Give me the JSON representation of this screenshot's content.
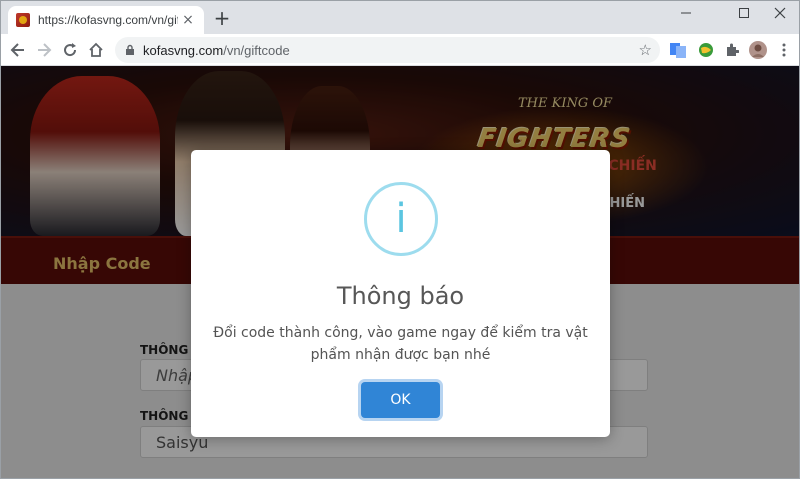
{
  "browser": {
    "tab_title": "https://kofasvng.com/vn/giftcode",
    "tab_close": "×",
    "new_tab": "+",
    "url_host": "kofasvng.com",
    "url_path": "/vn/giftcode",
    "window_controls": [
      "minimize-icon",
      "maximize-icon",
      "close-icon"
    ]
  },
  "banner": {
    "logo_sub": "THE KING OF",
    "logo_main": "FIGHTERS",
    "logo_tag": "QUYỀN VƯƠNG CHIẾN",
    "logo_tag2": "CHIẾN"
  },
  "menu": {
    "item": "Nhập Code"
  },
  "form": {
    "label1": "THÔNG",
    "input1_placeholder": "Nhập",
    "label2": "THÔNG",
    "input2_value": "Saisyu"
  },
  "modal": {
    "icon": "i",
    "title": "Thông báo",
    "text": "Đổi code thành công, vào game ngay để kiểm tra vật phẩm nhận được bạn nhé",
    "ok_label": "OK"
  },
  "colors": {
    "ok_button": "#3085d6",
    "info_ring": "#9ddcee",
    "menubar": "#5c0d09",
    "menu_text": "#e8c36a"
  }
}
